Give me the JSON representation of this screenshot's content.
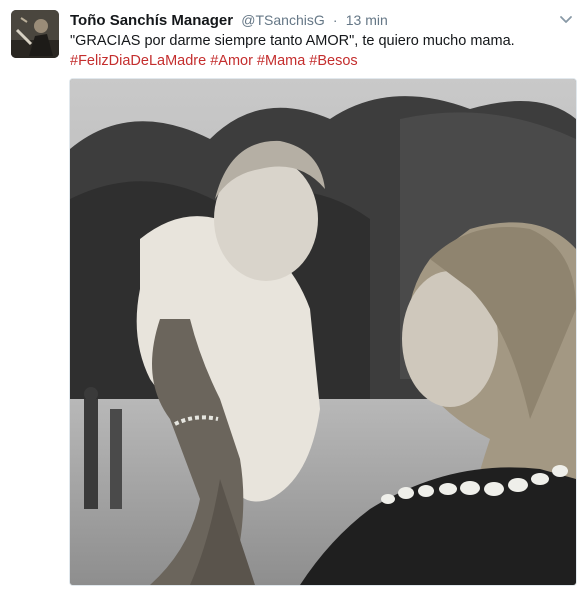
{
  "tweet": {
    "display_name": "Toño Sanchís Manager",
    "handle": "@TSanchisG",
    "separator": "·",
    "timestamp": "13 min",
    "text": "\"GRACIAS por darme siempre tanto AMOR\", te quiero mucho mama.",
    "hashtags": [
      "#FelizDiaDeLaMadre",
      "#Amor",
      "#Mama",
      "#Besos"
    ]
  },
  "icons": {
    "avatar": "profile-avatar",
    "menu": "chevron-down-icon"
  },
  "colors": {
    "hashtag": "#c42e2e",
    "meta": "#657786",
    "text": "#14171a"
  }
}
